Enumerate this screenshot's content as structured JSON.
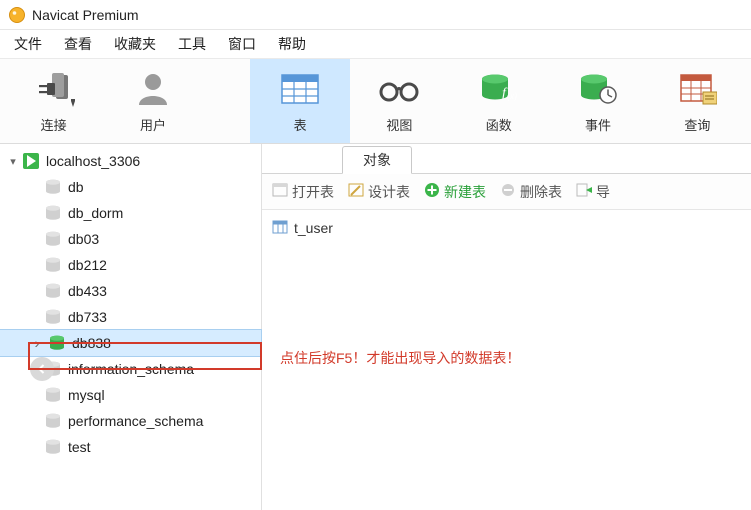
{
  "app": {
    "title": "Navicat Premium"
  },
  "menubar": [
    "文件",
    "查看",
    "收藏夹",
    "工具",
    "窗口",
    "帮助"
  ],
  "toolbar": [
    {
      "id": "connect",
      "label": "连接"
    },
    {
      "id": "user",
      "label": "用户"
    },
    {
      "id": "table",
      "label": "表",
      "active": true
    },
    {
      "id": "view",
      "label": "视图"
    },
    {
      "id": "func",
      "label": "函数"
    },
    {
      "id": "event",
      "label": "事件"
    },
    {
      "id": "query",
      "label": "查询"
    }
  ],
  "tree": {
    "connection": "localhost_3306",
    "databases": [
      {
        "name": "db"
      },
      {
        "name": "db_dorm"
      },
      {
        "name": "db03"
      },
      {
        "name": "db212"
      },
      {
        "name": "db433"
      },
      {
        "name": "db733"
      },
      {
        "name": "db838",
        "selected": true,
        "active": true
      },
      {
        "name": "information_schema"
      },
      {
        "name": "mysql"
      },
      {
        "name": "performance_schema"
      },
      {
        "name": "test"
      }
    ]
  },
  "right": {
    "tab": "对象",
    "actions": {
      "open": "打开表",
      "design": "设计表",
      "new": "新建表",
      "delete": "删除表",
      "import": "导"
    },
    "objects": [
      {
        "name": "t_user"
      }
    ]
  },
  "annotation": {
    "text": "点住后按F5！才能出现导入的数据表！",
    "color": "#d23a2a"
  }
}
